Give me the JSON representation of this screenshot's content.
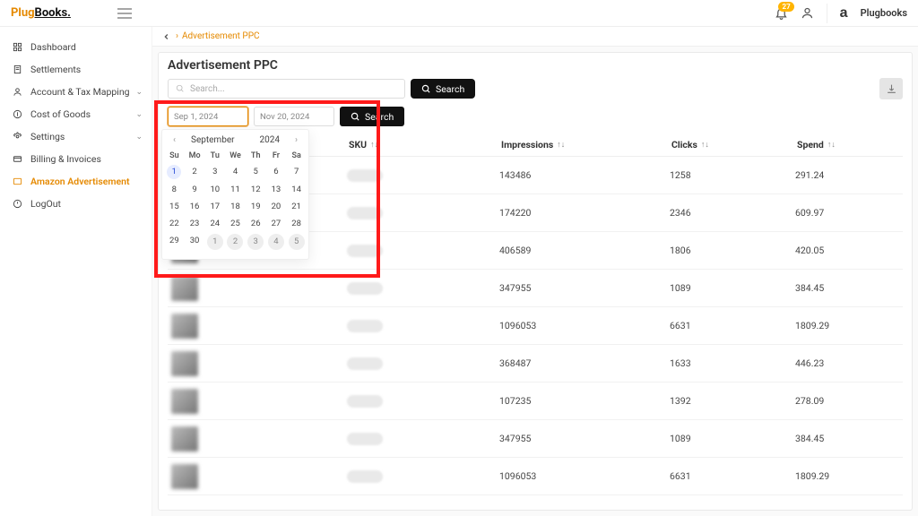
{
  "brand": {
    "p": "Plug",
    "rest": "Books.",
    "right_name": "Plugbooks",
    "notif_count": "27"
  },
  "sidebar": {
    "items": [
      {
        "label": "Dashboard",
        "icon": "grid",
        "sub": false
      },
      {
        "label": "Settlements",
        "icon": "doc",
        "sub": false
      },
      {
        "label": "Account & Tax Mapping",
        "icon": "user",
        "sub": true
      },
      {
        "label": "Cost of Goods",
        "icon": "tag",
        "sub": true
      },
      {
        "label": "Settings",
        "icon": "gear",
        "sub": true
      },
      {
        "label": "Billing & Invoices",
        "icon": "card",
        "sub": false
      },
      {
        "label": "Amazon Advertisement",
        "icon": "ad",
        "sub": false,
        "active": true
      },
      {
        "label": "LogOut",
        "icon": "logout",
        "sub": false
      }
    ]
  },
  "crumb": {
    "text": "Advertisement PPC"
  },
  "page": {
    "title": "Advertisement PPC",
    "search_placeholder": "Search...",
    "search_btn": "Search",
    "date_from": "Sep 1, 2024",
    "date_to": "Nov 20, 2024",
    "date_search_btn": "Search"
  },
  "calendar": {
    "month": "September",
    "year": "2024",
    "dow": [
      "Su",
      "Mo",
      "Tu",
      "We",
      "Th",
      "Fr",
      "Sa"
    ],
    "selected": 1,
    "days": [
      1,
      2,
      3,
      4,
      5,
      6,
      7,
      8,
      9,
      10,
      11,
      12,
      13,
      14,
      15,
      16,
      17,
      18,
      19,
      20,
      21,
      22,
      23,
      24,
      25,
      26,
      27,
      28,
      29,
      30
    ],
    "trailing_next": [
      1,
      2,
      3,
      4,
      5
    ]
  },
  "table": {
    "columns": [
      "",
      "SKU",
      "Impressions",
      "Clicks",
      "Spend"
    ],
    "rows": [
      {
        "impressions": "143486",
        "clicks": "1258",
        "spend": "291.24"
      },
      {
        "impressions": "174220",
        "clicks": "2346",
        "spend": "609.97"
      },
      {
        "impressions": "406589",
        "clicks": "1806",
        "spend": "420.05"
      },
      {
        "impressions": "347955",
        "clicks": "1089",
        "spend": "384.45"
      },
      {
        "impressions": "1096053",
        "clicks": "6631",
        "spend": "1809.29"
      },
      {
        "impressions": "368487",
        "clicks": "1633",
        "spend": "446.23"
      },
      {
        "impressions": "107235",
        "clicks": "1392",
        "spend": "278.09"
      },
      {
        "impressions": "347955",
        "clicks": "1089",
        "spend": "384.45"
      },
      {
        "impressions": "1096053",
        "clicks": "6631",
        "spend": "1809.29"
      }
    ]
  }
}
